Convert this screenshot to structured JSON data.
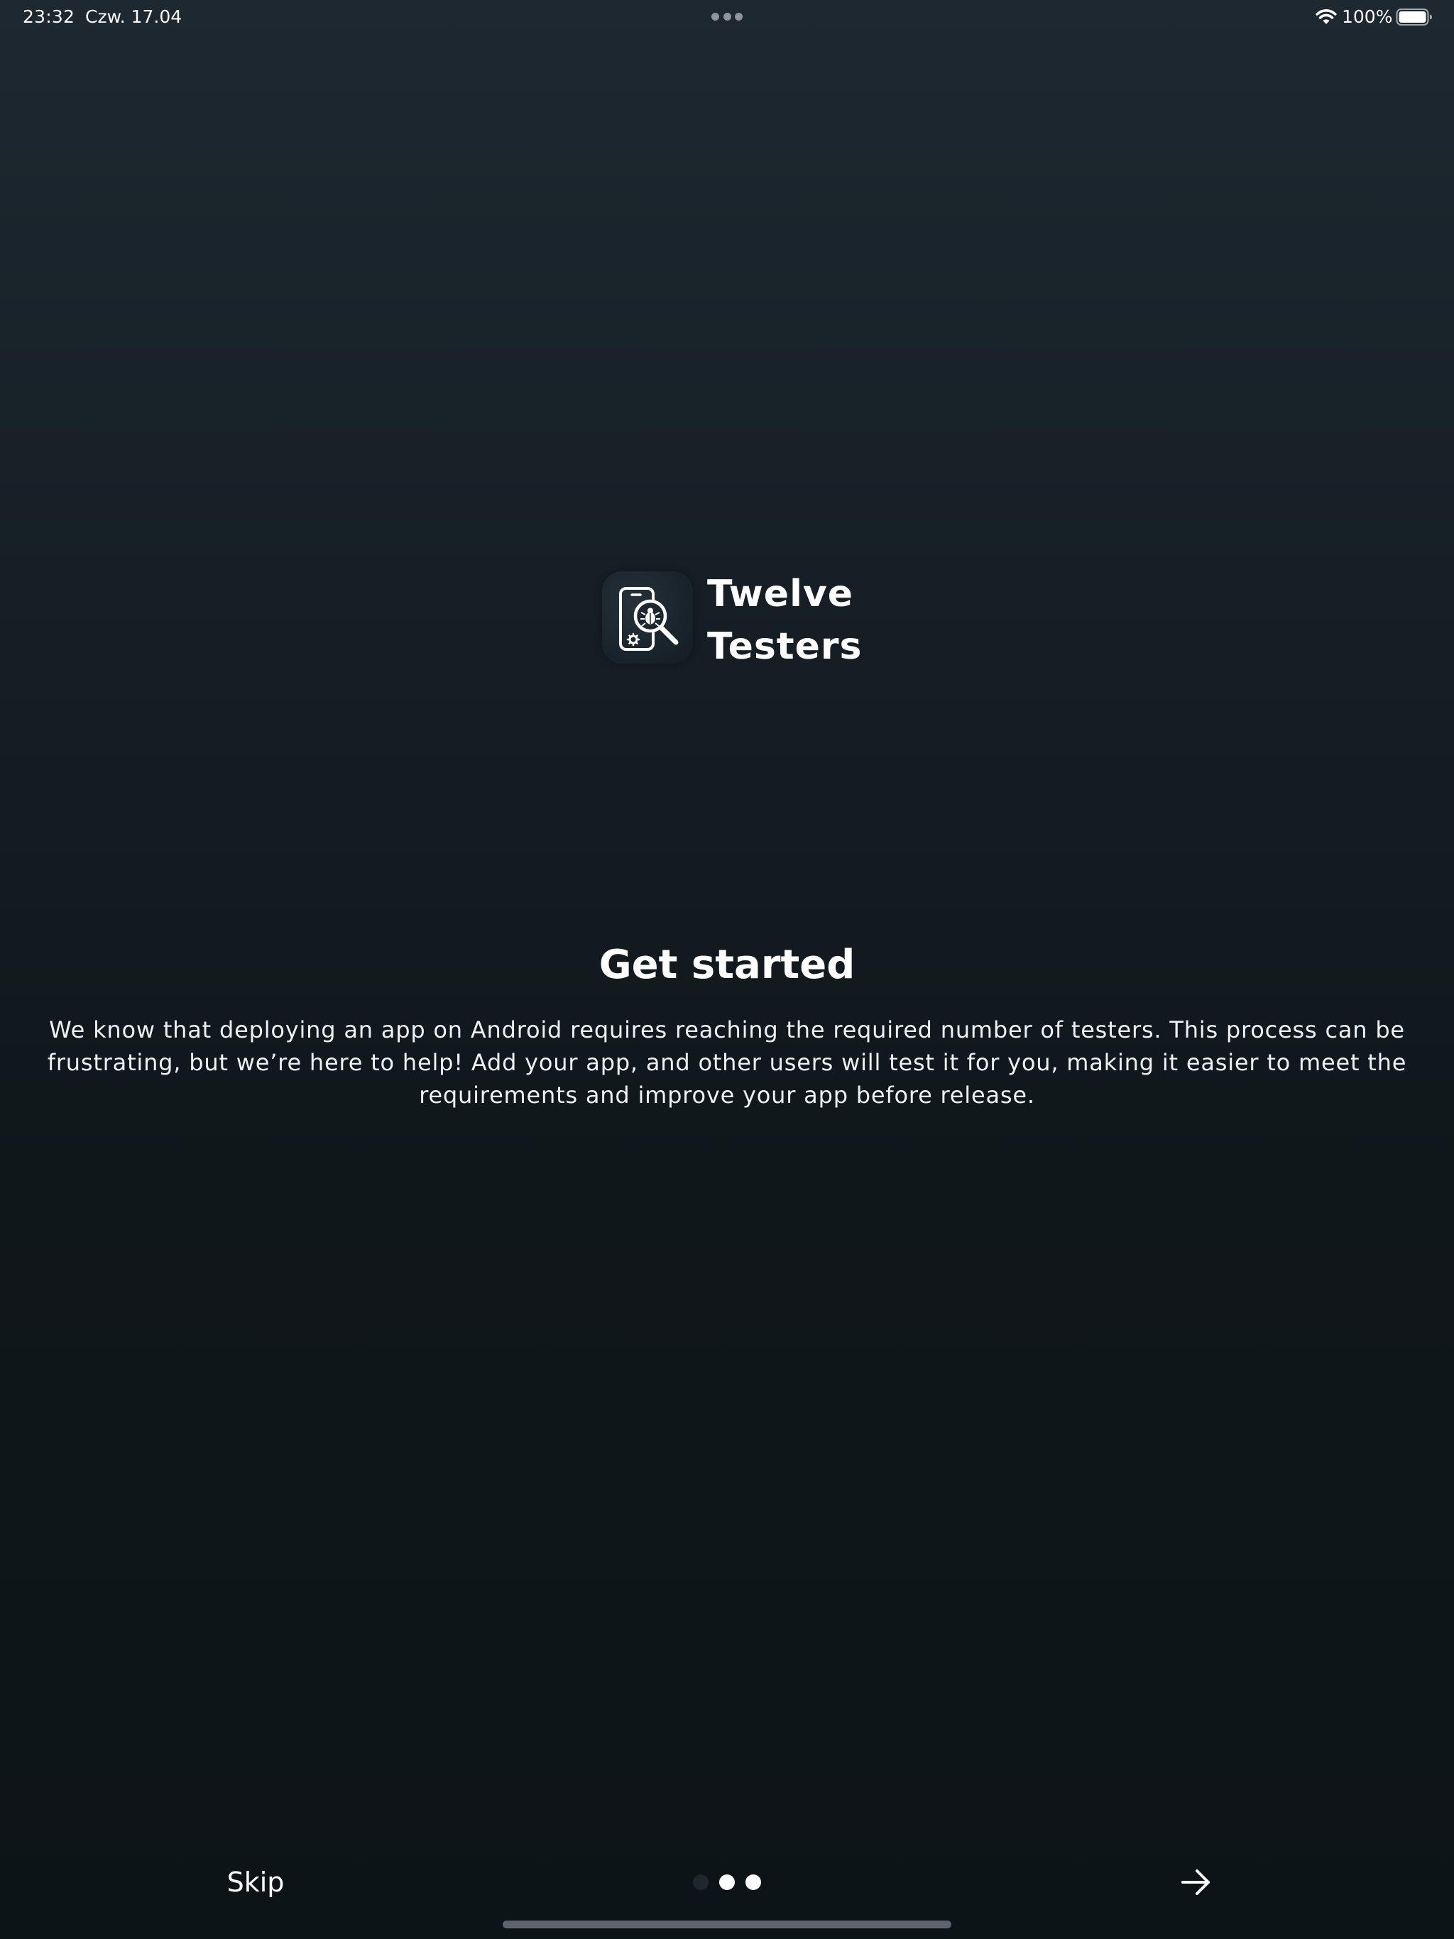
{
  "status_bar": {
    "time": "23:32",
    "date": "Czw. 17.04",
    "battery_percent": "100%",
    "battery_level": 1.0,
    "icons": [
      "multitasking-dots-icon",
      "wifi-icon",
      "battery-icon"
    ]
  },
  "logo": {
    "app_name": "Twelve\nTesters",
    "icon": "phone-bug-magnifier-icon"
  },
  "content": {
    "headline": "Get started",
    "description": "We know that deploying an app on Android requires reaching the required number of testers. This process can be frustrating, but we’re here to help! Add your app, and other users will test it for you, making it easier to meet the requirements and improve your app before release."
  },
  "navigation": {
    "skip_label": "Skip",
    "next_icon": "arrow-right-icon",
    "pages": 3,
    "current_page": 1
  },
  "colors": {
    "background_top": "#1d2830",
    "background_bottom": "#0d1417",
    "text": "#ffffff",
    "inactive_dot": "#1e272e",
    "home_indicator": "#5e6469"
  }
}
